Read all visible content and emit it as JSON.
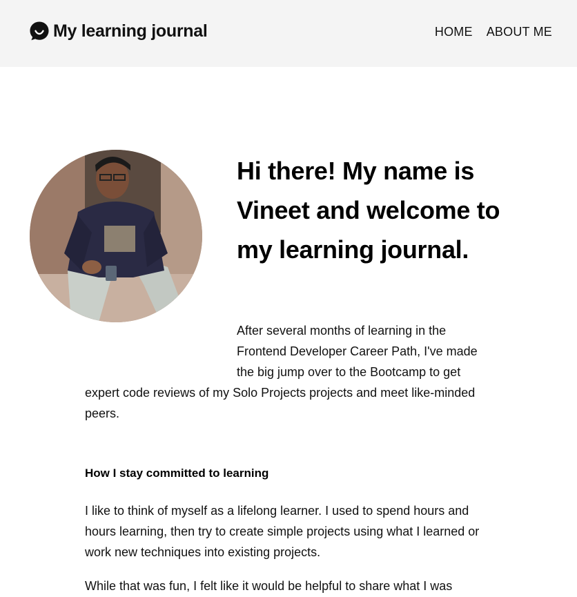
{
  "header": {
    "brand_icon": "chat-bubble-icon",
    "title": "My learning journal",
    "nav": [
      {
        "label": "HOME"
      },
      {
        "label": "ABOUT ME"
      }
    ]
  },
  "hero": {
    "avatar": "profile-photo",
    "title": "Hi there! My name is Vineet and welcome to my learning journal.",
    "intro_lines": [
      "After several months of learning in the",
      "Frontend Developer Career Path, I've made",
      "the big jump over to the Bootcamp to get",
      "expert code reviews of my Solo Projects projects and meet like-minded",
      "peers."
    ]
  },
  "section": {
    "heading": "How I stay committed to learning",
    "paragraph_1": "I like to think of myself as a lifelong learner. I used to spend hours and hours learning, then try to create simple projects using what I learned or work new techniques into existing projects.",
    "paragraph_2": "While that was fun, I felt like it would be helpful to share what I was"
  },
  "colors": {
    "header_bg": "#f4f4f4",
    "text": "#111111"
  }
}
